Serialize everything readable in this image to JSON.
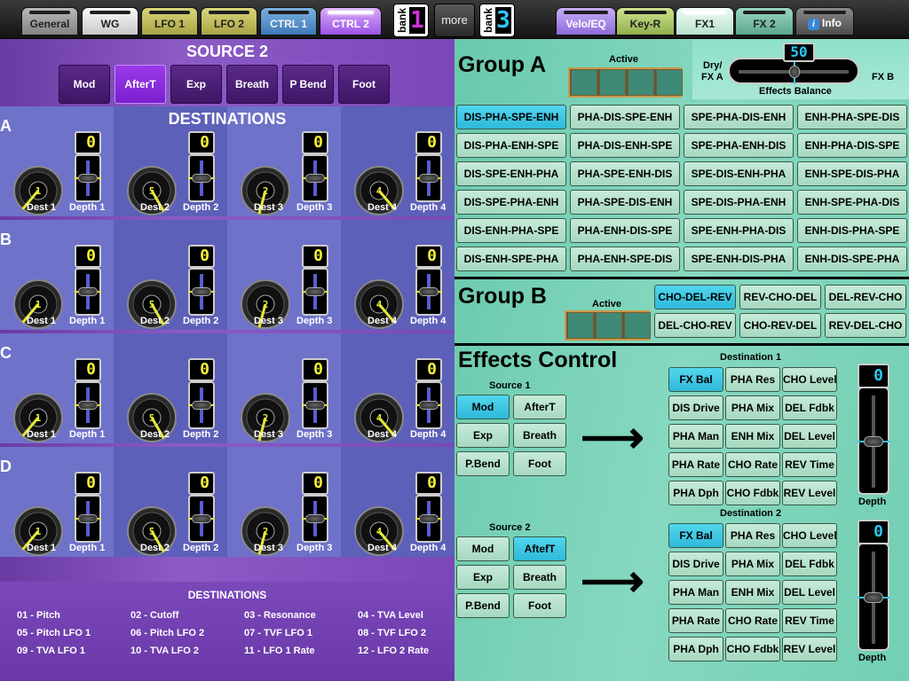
{
  "tabs": {
    "left": [
      {
        "label": "General",
        "cls": "t-general"
      },
      {
        "label": "WG",
        "cls": "t-wg"
      },
      {
        "label": "LFO 1",
        "cls": "t-lfo"
      },
      {
        "label": "LFO 2",
        "cls": "t-lfo"
      },
      {
        "label": "CTRL 1",
        "cls": "t-ctrl1"
      },
      {
        "label": "CTRL 2",
        "cls": "t-ctrl2",
        "active": true
      }
    ],
    "right": [
      {
        "label": "Velo/EQ",
        "cls": "t-velo"
      },
      {
        "label": "Key-R",
        "cls": "t-keyr"
      },
      {
        "label": "FX1",
        "cls": "t-fx1",
        "active": true
      },
      {
        "label": "FX 2",
        "cls": "t-fx2"
      },
      {
        "label": "Info",
        "cls": "t-info",
        "icon": "info-icon"
      }
    ],
    "bank_label": "bank",
    "bank_left_digit": "1",
    "bank_right_digit": "3",
    "more_label": "more"
  },
  "ctrl": {
    "source_title": "SOURCE 2",
    "sources": [
      "Mod",
      "AfterT",
      "Exp",
      "Breath",
      "P Bend",
      "Foot"
    ],
    "selected_source": "AfterT",
    "destinations_title": "DESTINATIONS",
    "rows": [
      {
        "letter": "A",
        "dests": [
          {
            "label": "Dest 1",
            "knob": "1",
            "depth_label": "Depth 1",
            "depth": "0"
          },
          {
            "label": "Dest 2",
            "knob": "5",
            "depth_label": "Depth 2",
            "depth": "0"
          },
          {
            "label": "Dest 3",
            "knob": "2",
            "depth_label": "Depth 3",
            "depth": "0"
          },
          {
            "label": "Dest 4",
            "knob": "4",
            "depth_label": "Depth 4",
            "depth": "0"
          }
        ]
      },
      {
        "letter": "B",
        "dests": [
          {
            "label": "Dest 1",
            "knob": "1",
            "depth_label": "Depth 1",
            "depth": "0"
          },
          {
            "label": "Dest 2",
            "knob": "5",
            "depth_label": "Depth 2",
            "depth": "0"
          },
          {
            "label": "Dest 3",
            "knob": "2",
            "depth_label": "Depth 3",
            "depth": "0"
          },
          {
            "label": "Dest 4",
            "knob": "4",
            "depth_label": "Depth 4",
            "depth": "0"
          }
        ]
      },
      {
        "letter": "C",
        "dests": [
          {
            "label": "Dest 1",
            "knob": "1",
            "depth_label": "Depth 1",
            "depth": "0"
          },
          {
            "label": "Dest 2",
            "knob": "5",
            "depth_label": "Depth 2",
            "depth": "0"
          },
          {
            "label": "Dest 3",
            "knob": "2",
            "depth_label": "Depth 3",
            "depth": "0"
          },
          {
            "label": "Dest 4",
            "knob": "4",
            "depth_label": "Depth 4",
            "depth": "0"
          }
        ]
      },
      {
        "letter": "D",
        "dests": [
          {
            "label": "Dest 1",
            "knob": "1",
            "depth_label": "Depth 1",
            "depth": "0"
          },
          {
            "label": "Dest 2",
            "knob": "5",
            "depth_label": "Depth 2",
            "depth": "0"
          },
          {
            "label": "Dest 3",
            "knob": "2",
            "depth_label": "Depth 3",
            "depth": "0"
          },
          {
            "label": "Dest 4",
            "knob": "4",
            "depth_label": "Depth 4",
            "depth": "0"
          }
        ]
      }
    ],
    "legend_title": "DESTINATIONS",
    "legend": [
      "01 - Pitch",
      "02 - Cutoff",
      "03 - Resonance",
      "04 - TVA Level",
      "05 - Pitch LFO 1",
      "06 - Pitch LFO 2",
      "07 - TVF LFO 1",
      "08 - TVF LFO 2",
      "09 - TVA LFO 1",
      "10 - TVA LFO 2",
      "11 - LFO 1 Rate",
      "12 - LFO 2 Rate"
    ]
  },
  "fx": {
    "group_a_title": "Group A",
    "active_label": "Active",
    "dry_label": "Dry/",
    "fxa_label": "FX A",
    "fxb_label": "FX B",
    "balance_label": "Effects Balance",
    "balance_value": "50",
    "group_a": [
      "DIS-PHA-SPE-ENH",
      "PHA-DIS-SPE-ENH",
      "SPE-PHA-DIS-ENH",
      "ENH-PHA-SPE-DIS",
      "DIS-PHA-ENH-SPE",
      "PHA-DIS-ENH-SPE",
      "SPE-PHA-ENH-DIS",
      "ENH-PHA-DIS-SPE",
      "DIS-SPE-ENH-PHA",
      "PHA-SPE-ENH-DIS",
      "SPE-DIS-ENH-PHA",
      "ENH-SPE-DIS-PHA",
      "DIS-SPE-PHA-ENH",
      "PHA-SPE-DIS-ENH",
      "SPE-DIS-PHA-ENH",
      "ENH-SPE-PHA-DIS",
      "DIS-ENH-PHA-SPE",
      "PHA-ENH-DIS-SPE",
      "SPE-ENH-PHA-DIS",
      "ENH-DIS-PHA-SPE",
      "DIS-ENH-SPE-PHA",
      "PHA-ENH-SPE-DIS",
      "SPE-ENH-DIS-PHA",
      "ENH-DIS-SPE-PHA"
    ],
    "group_a_selected": "DIS-PHA-SPE-ENH",
    "group_b_title": "Group B",
    "group_b": [
      "CHO-DEL-REV",
      "REV-CHO-DEL",
      "DEL-REV-CHO",
      "DEL-CHO-REV",
      "CHO-REV-DEL",
      "REV-DEL-CHO"
    ],
    "group_b_selected": "CHO-DEL-REV",
    "effects_control_title": "Effects Control",
    "source1_label": "Source 1",
    "source2_label": "Source 2",
    "source1": [
      "Mod",
      "AfterT",
      "Exp",
      "Breath",
      "P.Bend",
      "Foot"
    ],
    "source1_selected": "Mod",
    "source2": [
      "Mod",
      "AftefT",
      "Exp",
      "Breath",
      "P.Bend",
      "Foot"
    ],
    "source2_selected": "AftefT",
    "dest1_label": "Destination 1",
    "dest2_label": "Destination 2",
    "dest_params": [
      "FX Bal",
      "PHA Res",
      "CHO Level",
      "DIS Drive",
      "PHA Mix",
      "DEL Fdbk",
      "PHA Man",
      "ENH Mix",
      "DEL Level",
      "PHA Rate",
      "CHO Rate",
      "REV Time",
      "PHA Dph",
      "CHO Fdbk",
      "REV Level"
    ],
    "dest1_selected": "FX Bal",
    "dest2_selected": "FX Bal",
    "depth_label": "Depth",
    "depth1": "0",
    "depth2": "0",
    "arrow_glyph": "⟶"
  },
  "colors": {
    "selected_cyan": "#2eb9d9",
    "selected_purple": "#9b3be8",
    "meter_yellow": "#f4ef3a",
    "meter_cyan": "#29c7f5"
  }
}
